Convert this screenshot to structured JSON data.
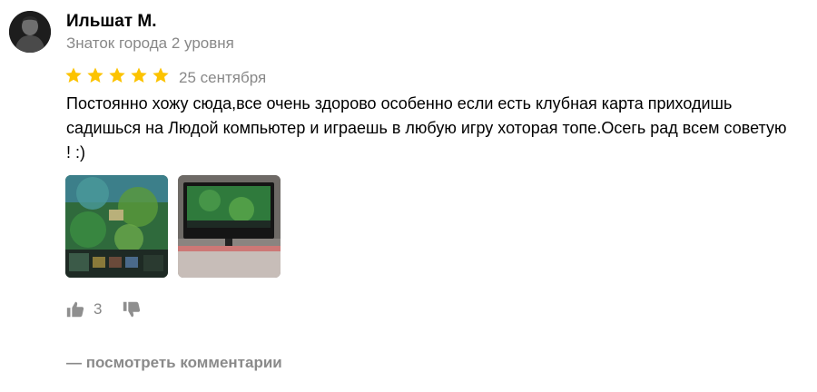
{
  "author": {
    "name": "Ильшат М.",
    "level": "Знаток города 2 уровня",
    "avatar_icon": "user-avatar"
  },
  "review": {
    "rating": 5,
    "rating_max": 5,
    "date": "25 сентября",
    "text": "Постоянно хожу сюда,все очень здорово особенно если есть клубная карта приходишь садишься на Людой компьютер и играешь в любую игру хоторая топе.Осегь рад всем советую ! :)",
    "photos": [
      {
        "icon": "game-screenshot-photo"
      },
      {
        "icon": "monitor-photo"
      }
    ]
  },
  "reactions": {
    "like_icon": "thumbs-up-icon",
    "like_count": "3",
    "dislike_icon": "thumbs-down-icon"
  },
  "comments": {
    "label": "— посмотреть комментарии"
  },
  "colors": {
    "star": "#fcc300",
    "secondary_text": "#888888",
    "icon_gray": "#8f8f8f"
  }
}
